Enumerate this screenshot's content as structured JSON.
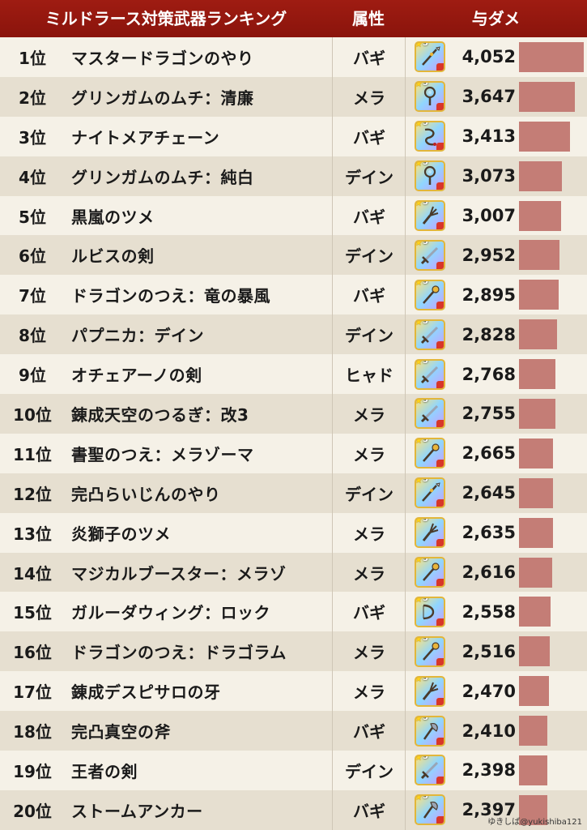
{
  "header": {
    "title": "ミルドラース対策武器ランキング",
    "attr": "属性",
    "damage": "与ダメ"
  },
  "colors": {
    "header_bg": "#9f1c12",
    "bar": "#c47d76",
    "row_odd": "#f5f1e7",
    "row_even": "#e6dfd0"
  },
  "max_damage": 4052,
  "rows": [
    {
      "rank": "1位",
      "name": "マスタードラゴンのやり",
      "attr": "バギ",
      "damage": "4,052",
      "value": 4052,
      "icon": "spear-icon"
    },
    {
      "rank": "2位",
      "name": "グリンガムのムチ：清廉",
      "attr": "メラ",
      "damage": "3,647",
      "value": 3647,
      "icon": "whip-icon"
    },
    {
      "rank": "3位",
      "name": "ナイトメアチェーン",
      "attr": "バギ",
      "damage": "3,413",
      "value": 3413,
      "icon": "chain-whip-icon"
    },
    {
      "rank": "4位",
      "name": "グリンガムのムチ：純白",
      "attr": "デイン",
      "damage": "3,073",
      "value": 3073,
      "icon": "whip-icon"
    },
    {
      "rank": "5位",
      "name": "黒嵐のツメ",
      "attr": "バギ",
      "damage": "3,007",
      "value": 3007,
      "icon": "claw-icon"
    },
    {
      "rank": "6位",
      "name": "ルビスの剣",
      "attr": "デイン",
      "damage": "2,952",
      "value": 2952,
      "icon": "sword-icon"
    },
    {
      "rank": "7位",
      "name": "ドラゴンのつえ：竜の暴風",
      "attr": "バギ",
      "damage": "2,895",
      "value": 2895,
      "icon": "staff-icon"
    },
    {
      "rank": "8位",
      "name": "パプニカ：デイン",
      "attr": "デイン",
      "damage": "2,828",
      "value": 2828,
      "icon": "sword-icon"
    },
    {
      "rank": "9位",
      "name": "オチェアーノの剣",
      "attr": "ヒャド",
      "damage": "2,768",
      "value": 2768,
      "icon": "sword-icon"
    },
    {
      "rank": "10位",
      "name": "錬成天空のつるぎ：改3",
      "attr": "メラ",
      "damage": "2,755",
      "value": 2755,
      "icon": "sword-icon"
    },
    {
      "rank": "11位",
      "name": "書聖のつえ：メラゾーマ",
      "attr": "メラ",
      "damage": "2,665",
      "value": 2665,
      "icon": "staff-icon"
    },
    {
      "rank": "12位",
      "name": "完凸らいじんのやり",
      "attr": "デイン",
      "damage": "2,645",
      "value": 2645,
      "icon": "spear-icon"
    },
    {
      "rank": "13位",
      "name": "炎獅子のツメ",
      "attr": "メラ",
      "damage": "2,635",
      "value": 2635,
      "icon": "claw-icon"
    },
    {
      "rank": "14位",
      "name": "マジカルブースター：メラゾ",
      "attr": "メラ",
      "damage": "2,616",
      "value": 2616,
      "icon": "staff-icon"
    },
    {
      "rank": "15位",
      "name": "ガルーダウィング：ロック",
      "attr": "バギ",
      "damage": "2,558",
      "value": 2558,
      "icon": "bow-icon"
    },
    {
      "rank": "16位",
      "name": "ドラゴンのつえ：ドラゴラム",
      "attr": "メラ",
      "damage": "2,516",
      "value": 2516,
      "icon": "staff-icon"
    },
    {
      "rank": "17位",
      "name": "錬成デスピサロの牙",
      "attr": "メラ",
      "damage": "2,470",
      "value": 2470,
      "icon": "claw-icon"
    },
    {
      "rank": "18位",
      "name": "完凸真空の斧",
      "attr": "バギ",
      "damage": "2,410",
      "value": 2410,
      "icon": "axe-icon"
    },
    {
      "rank": "19位",
      "name": "王者の剣",
      "attr": "デイン",
      "damage": "2,398",
      "value": 2398,
      "icon": "sword-icon"
    },
    {
      "rank": "20位",
      "name": "ストームアンカー",
      "attr": "バギ",
      "damage": "2,397",
      "value": 2397,
      "icon": "axe-icon"
    }
  ],
  "icon_badge": "5",
  "watermark": "ゆきしば@yukishiba121"
}
